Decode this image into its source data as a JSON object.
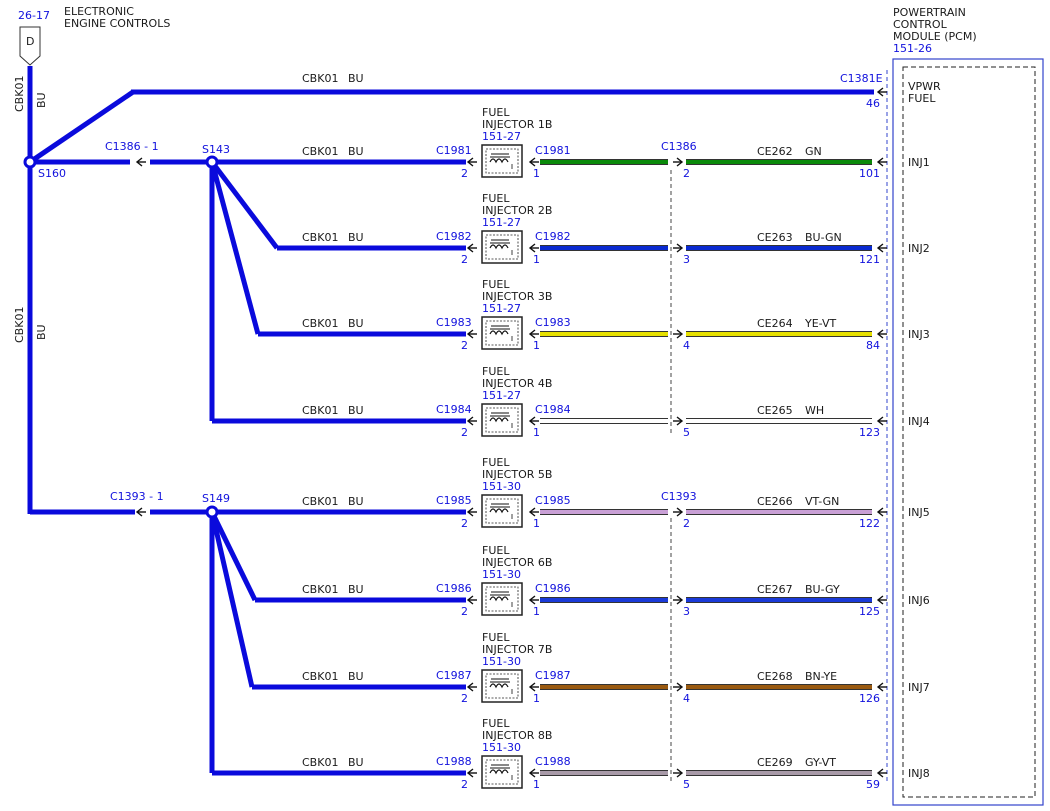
{
  "header": {
    "page_ref": "26-17",
    "marker": "D",
    "title_line1": "ELECTRONIC",
    "title_line2": "ENGINE CONTROLS"
  },
  "pcm": {
    "title_lines": [
      "POWERTRAIN",
      "CONTROL",
      "MODULE (PCM)"
    ],
    "page_ref": "151-26",
    "vpwr": {
      "connector": "C1381E",
      "pin": "46",
      "label_line1": "VPWR",
      "label_line2": "FUEL",
      "circuit": "CBK01",
      "color": "BU"
    }
  },
  "trunk": {
    "circuit": "CBK01",
    "color": "BU",
    "splice_main": "S160"
  },
  "groups": [
    {
      "splice": "S143",
      "inline_connector": "C1386 - 1",
      "pcm_side_connector": "C1386"
    },
    {
      "splice": "S149",
      "inline_connector": "C1393 - 1",
      "pcm_side_connector": "C1393"
    }
  ],
  "colors": {
    "BU": "#0a0adc",
    "GN": "#0a8a0a",
    "BU-GN": "#0a2ad0",
    "YE-VT": "#e6e000",
    "WH": "#ffffff",
    "VT-GN": "#c9a0d6",
    "BU-GY": "#1a3ad8",
    "BN-YE": "#9a5a10",
    "GY-VT": "#a89aa8",
    "label_blue": "#1111dd"
  },
  "injectors": [
    {
      "name_line1": "FUEL",
      "name_line2": "INJECTOR 1B",
      "page_ref": "151-27",
      "connector": "C1981",
      "pin_in": "2",
      "pin_out": "1",
      "left_circuit": "CBK01",
      "left_color": "BU",
      "inline_pin": "2",
      "circuit": "CE262",
      "color": "GN",
      "pcm_pin": "101",
      "pcm_label": "INJ1"
    },
    {
      "name_line1": "FUEL",
      "name_line2": "INJECTOR 2B",
      "page_ref": "151-27",
      "connector": "C1982",
      "pin_in": "2",
      "pin_out": "1",
      "left_circuit": "CBK01",
      "left_color": "BU",
      "inline_pin": "3",
      "circuit": "CE263",
      "color": "BU-GN",
      "pcm_pin": "121",
      "pcm_label": "INJ2"
    },
    {
      "name_line1": "FUEL",
      "name_line2": "INJECTOR 3B",
      "page_ref": "151-27",
      "connector": "C1983",
      "pin_in": "2",
      "pin_out": "1",
      "left_circuit": "CBK01",
      "left_color": "BU",
      "inline_pin": "4",
      "circuit": "CE264",
      "color": "YE-VT",
      "pcm_pin": "84",
      "pcm_label": "INJ3"
    },
    {
      "name_line1": "FUEL",
      "name_line2": "INJECTOR 4B",
      "page_ref": "151-27",
      "connector": "C1984",
      "pin_in": "2",
      "pin_out": "1",
      "left_circuit": "CBK01",
      "left_color": "BU",
      "inline_pin": "5",
      "circuit": "CE265",
      "color": "WH",
      "pcm_pin": "123",
      "pcm_label": "INJ4"
    },
    {
      "name_line1": "FUEL",
      "name_line2": "INJECTOR 5B",
      "page_ref": "151-30",
      "connector": "C1985",
      "pin_in": "2",
      "pin_out": "1",
      "left_circuit": "CBK01",
      "left_color": "BU",
      "inline_pin": "2",
      "circuit": "CE266",
      "color": "VT-GN",
      "pcm_pin": "122",
      "pcm_label": "INJ5"
    },
    {
      "name_line1": "FUEL",
      "name_line2": "INJECTOR 6B",
      "page_ref": "151-30",
      "connector": "C1986",
      "pin_in": "2",
      "pin_out": "1",
      "left_circuit": "CBK01",
      "left_color": "BU",
      "inline_pin": "3",
      "circuit": "CE267",
      "color": "BU-GY",
      "pcm_pin": "125",
      "pcm_label": "INJ6"
    },
    {
      "name_line1": "FUEL",
      "name_line2": "INJECTOR 7B",
      "page_ref": "151-30",
      "connector": "C1987",
      "pin_in": "2",
      "pin_out": "1",
      "left_circuit": "CBK01",
      "left_color": "BU",
      "inline_pin": "4",
      "circuit": "CE268",
      "color": "BN-YE",
      "pcm_pin": "126",
      "pcm_label": "INJ7"
    },
    {
      "name_line1": "FUEL",
      "name_line2": "INJECTOR 8B",
      "page_ref": "151-30",
      "connector": "C1988",
      "pin_in": "2",
      "pin_out": "1",
      "left_circuit": "CBK01",
      "left_color": "BU",
      "inline_pin": "5",
      "circuit": "CE269",
      "color": "GY-VT",
      "pcm_pin": "59",
      "pcm_label": "INJ8"
    }
  ]
}
